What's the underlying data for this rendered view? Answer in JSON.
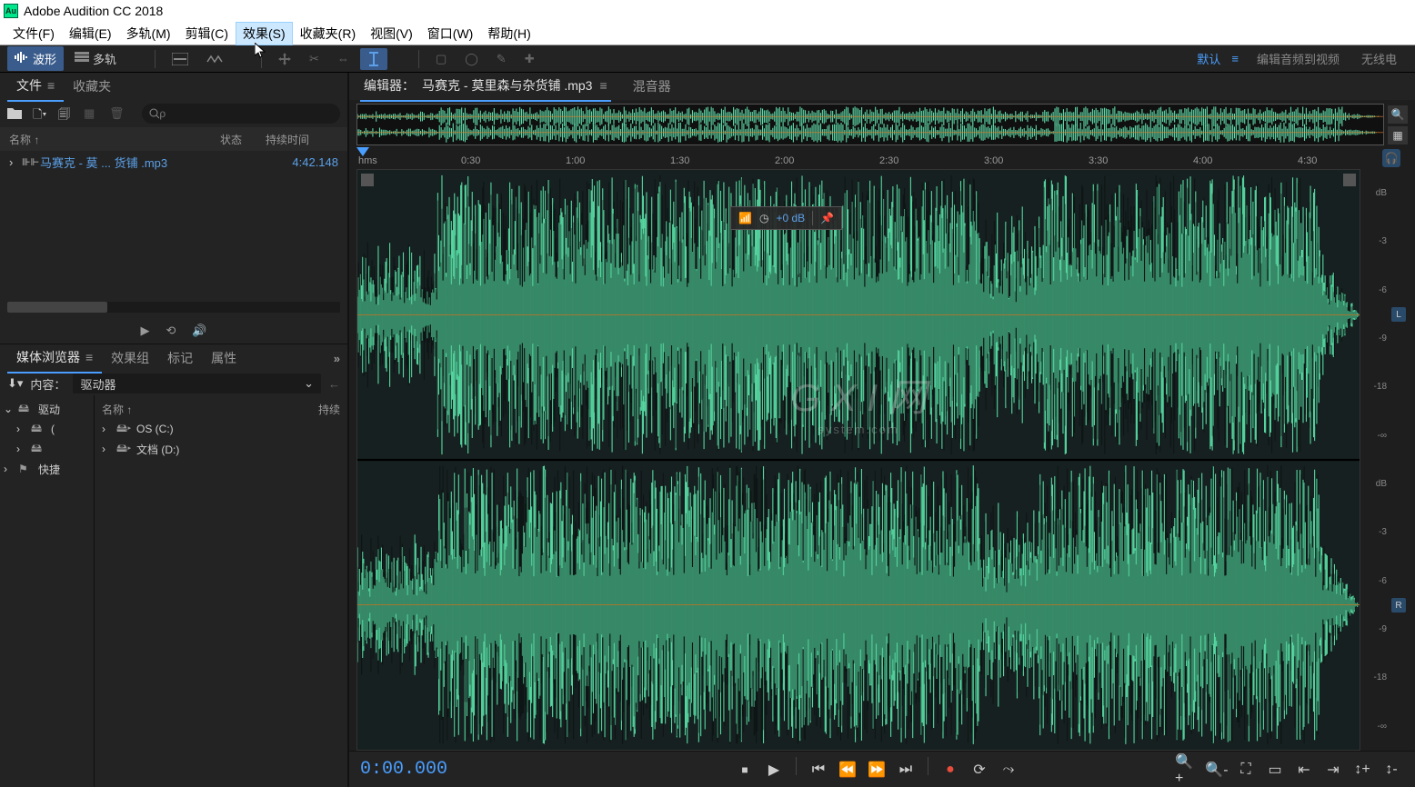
{
  "app": {
    "title": "Adobe Audition CC 2018",
    "logo_text": "Au"
  },
  "menu": {
    "file": "文件(F)",
    "edit": "编辑(E)",
    "multitrack": "多轨(M)",
    "clip": "剪辑(C)",
    "effects": "效果(S)",
    "favorites": "收藏夹(R)",
    "view": "视图(V)",
    "window": "窗口(W)",
    "help": "帮助(H)"
  },
  "toolbar": {
    "waveform": "波形",
    "multitrack": "多轨",
    "workspaces": {
      "default": "默认",
      "edit_av": "编辑音频到视频",
      "wireless": "无线电"
    }
  },
  "files_panel": {
    "tab_files": "文件",
    "tab_fav": "收藏夹",
    "header_name": "名称 ↑",
    "header_status": "状态",
    "header_duration": "持续时间",
    "search_placeholder": "ρ",
    "items": [
      {
        "name": "马赛克 - 莫 ... 货铺 .mp3",
        "duration": "4:42.148"
      }
    ]
  },
  "media_panel": {
    "tab_browser": "媒体浏览器",
    "tab_effects": "效果组",
    "tab_markers": "标记",
    "tab_properties": "属性",
    "content_label": "内容：",
    "content_value": "驱动器",
    "tree_left": [
      "驱动",
      "快捷"
    ],
    "header_name": "名称 ↑",
    "header_dur": "持续",
    "tree_right": [
      "OS (C:)",
      "文档 (D:)"
    ]
  },
  "editor": {
    "tab_prefix": "编辑器：",
    "filename": "马赛克 - 莫里森与杂货铺 .mp3",
    "tab_mixer": "混音器",
    "ruler_unit": "hms",
    "ruler_marks": [
      "0:30",
      "1:00",
      "1:30",
      "2:00",
      "2:30",
      "3:00",
      "3:30",
      "4:00",
      "4:30"
    ],
    "hud_gain": "+0 dB",
    "db_labels": [
      "dB",
      "-3",
      "-6",
      "-9",
      "-18",
      "-∞",
      "dB",
      "-3",
      "-6",
      "-9",
      "-18",
      "-∞"
    ],
    "channel_L": "L",
    "channel_R": "R",
    "watermark_main": "G X I 网",
    "watermark_sub": "system.com"
  },
  "transport": {
    "timecode": "0:00.000"
  }
}
